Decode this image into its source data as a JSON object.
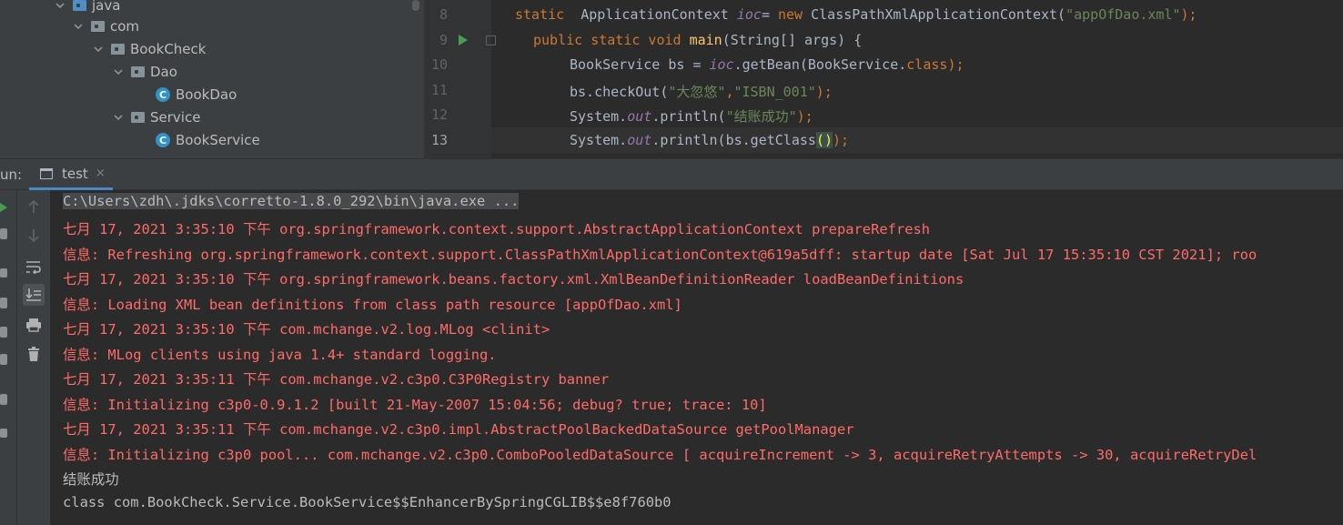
{
  "project_tree": {
    "items": [
      {
        "label": "java",
        "icon": "source-folder-icon"
      },
      {
        "label": "com",
        "icon": "package-icon"
      },
      {
        "label": "BookCheck",
        "icon": "package-icon"
      },
      {
        "label": "Dao",
        "icon": "package-icon"
      },
      {
        "label": "BookDao",
        "icon": "class-icon"
      },
      {
        "label": "Service",
        "icon": "package-icon"
      },
      {
        "label": "BookService",
        "icon": "class-icon"
      }
    ]
  },
  "editor": {
    "line_numbers": [
      "8",
      "9",
      "10",
      "11",
      "12",
      "13"
    ],
    "current_line": "13",
    "lines": {
      "l8": {
        "kw1": "static",
        "type": "  ApplicationContext ",
        "field": "ioc",
        "eq": "= ",
        "kw2": "new",
        "rest": " ClassPathXmlApplicationContext(",
        "str": "\"appOfDao.xml\"",
        "end": ");"
      },
      "l9": {
        "kw": "public static void ",
        "fn": "main",
        "rest": "(String[] args) {"
      },
      "l10": {
        "a": "BookService bs = ",
        "field": "ioc",
        "b": ".getBean(BookService.",
        "kw": "class",
        "c": ");"
      },
      "l11": {
        "a": "bs.checkOut(",
        "s1": "\"大忽悠\"",
        "comma": ",",
        "s2": "\"ISBN_001\"",
        "c": ");"
      },
      "l12": {
        "a": "System.",
        "field": "out",
        "b": ".println(",
        "s": "\"结账成功\"",
        "c": ");"
      },
      "l13": {
        "a": "System.",
        "field": "out",
        "b": ".println(bs.getClass",
        "paren": "()",
        "c": ");"
      }
    }
  },
  "run_panel": {
    "label": "un:",
    "tab_title": "test",
    "tab_close": "×"
  },
  "console": {
    "lines": [
      {
        "text": "C:\\Users\\zdh\\.jdks\\corretto-1.8.0_292\\bin\\java.exe ...",
        "kind": "cmd"
      },
      {
        "text": "七月 17, 2021 3:35:10 下午 org.springframework.context.support.AbstractApplicationContext prepareRefresh",
        "kind": "err"
      },
      {
        "text": "信息: Refreshing org.springframework.context.support.ClassPathXmlApplicationContext@619a5dff: startup date [Sat Jul 17 15:35:10 CST 2021]; roo",
        "kind": "err"
      },
      {
        "text": "七月 17, 2021 3:35:10 下午 org.springframework.beans.factory.xml.XmlBeanDefinitionReader loadBeanDefinitions",
        "kind": "err"
      },
      {
        "text": "信息: Loading XML bean definitions from class path resource [appOfDao.xml]",
        "kind": "err"
      },
      {
        "text": "七月 17, 2021 3:35:10 下午 com.mchange.v2.log.MLog <clinit>",
        "kind": "err"
      },
      {
        "text": "信息: MLog clients using java 1.4+ standard logging.",
        "kind": "err"
      },
      {
        "text": "七月 17, 2021 3:35:11 下午 com.mchange.v2.c3p0.C3P0Registry banner",
        "kind": "err"
      },
      {
        "text": "信息: Initializing c3p0-0.9.1.2 [built 21-May-2007 15:04:56; debug? true; trace: 10]",
        "kind": "err"
      },
      {
        "text": "七月 17, 2021 3:35:11 下午 com.mchange.v2.c3p0.impl.AbstractPoolBackedDataSource getPoolManager",
        "kind": "err"
      },
      {
        "text": "信息: Initializing c3p0 pool... com.mchange.v2.c3p0.ComboPooledDataSource [ acquireIncrement -> 3, acquireRetryAttempts -> 30, acquireRetryDel",
        "kind": "err"
      },
      {
        "text": "结账成功",
        "kind": "out"
      },
      {
        "text": "class com.BookCheck.Service.BookService$$EnhancerBySpringCGLIB$$e8f760b0",
        "kind": "out"
      }
    ]
  },
  "colors": {
    "keyword": "#cc7832",
    "string": "#6a8759",
    "field": "#9876aa",
    "function": "#ffc66d",
    "stderr": "#ff6b68",
    "stdout": "#bbbbbb"
  }
}
